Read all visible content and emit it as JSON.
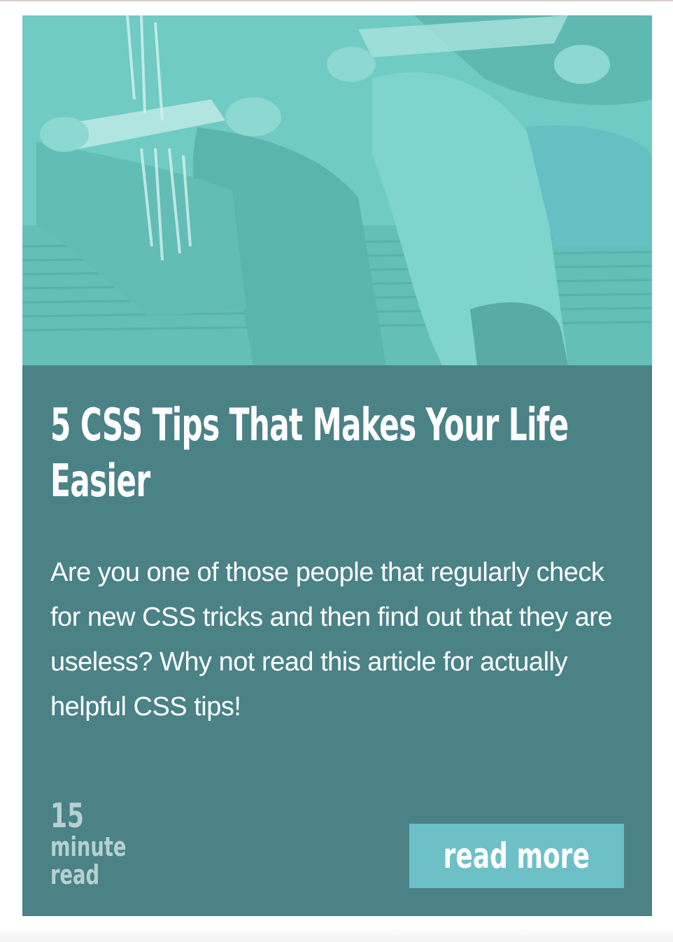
{
  "article": {
    "title": "5 CSS Tips That Makes Your Life Easier",
    "excerpt": "Are you one of those people that regularly check for new CSS tricks and then find out that they are useless? Why not read this article for actually helpful CSS tips!",
    "read_time": {
      "number": "15",
      "unit_line1": "minute",
      "unit_line2": "read"
    },
    "cta_label": "read more"
  },
  "colors": {
    "card_background": "#4a8286",
    "hero_tint": "#6fcbc4",
    "button_background": "#6dc0c6",
    "read_time_text": "#b8d0d1",
    "text": "#ffffff"
  }
}
